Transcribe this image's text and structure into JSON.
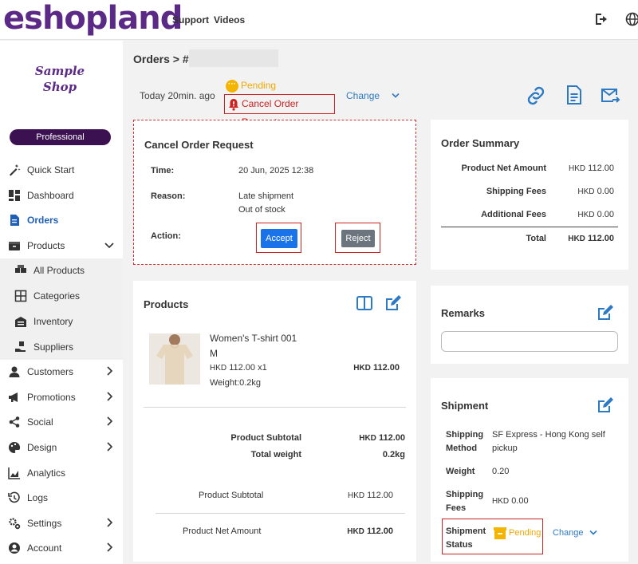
{
  "brand": {
    "logo": "eshopland"
  },
  "topnav": {
    "support": "Support",
    "videos": "Videos"
  },
  "sidebar": {
    "shop_name_line1": "Sample",
    "shop_name_line2": "Shop",
    "plan": "Professional",
    "items": [
      {
        "label": "Quick Start"
      },
      {
        "label": "Dashboard"
      },
      {
        "label": "Orders"
      },
      {
        "label": "Products"
      },
      {
        "label": "Customers"
      },
      {
        "label": "Promotions"
      },
      {
        "label": "Social"
      },
      {
        "label": "Design"
      },
      {
        "label": "Analytics"
      },
      {
        "label": "Logs"
      },
      {
        "label": "Settings"
      },
      {
        "label": "Account"
      }
    ],
    "sub_items": [
      {
        "label": "All Products"
      },
      {
        "label": "Categories"
      },
      {
        "label": "Inventory"
      },
      {
        "label": "Suppliers"
      }
    ]
  },
  "order": {
    "breadcrumb": "Orders > #",
    "time": "Today 20min. ago",
    "status": "Pending",
    "cancel_request_badge": "Cancel Order Request",
    "change": "Change"
  },
  "cancel_request": {
    "title": "Cancel Order Request",
    "time_label": "Time:",
    "time_value": "20 Jun, 2025 12:38",
    "reason_label": "Reason:",
    "reason_line1": "Late shipment",
    "reason_line2": "Out of stock",
    "action_label": "Action:",
    "accept": "Accept",
    "reject": "Reject"
  },
  "order_summary": {
    "title": "Order Summary",
    "rows": [
      {
        "label": "Product Net Amount",
        "currency": "HKD",
        "value": "112.00"
      },
      {
        "label": "Shipping Fees",
        "currency": "HKD",
        "value": "0.00"
      },
      {
        "label": "Additional Fees",
        "currency": "HKD",
        "value": "0.00"
      }
    ],
    "total_label": "Total",
    "total_currency": "HKD",
    "total_value": "112.00"
  },
  "products": {
    "title": "Products",
    "item": {
      "name": "Women's T-shirt 001",
      "variant": "M",
      "price_currency": "HKD",
      "price_qty": "112.00 x1",
      "weight": "Weight:0.2kg",
      "line_currency": "HKD",
      "line_total": "112.00"
    },
    "subtotal_label": "Product Subtotal",
    "subtotal_currency": "HKD",
    "subtotal_value": "112.00",
    "weight_label": "Total weight",
    "weight_value": "0.2kg",
    "subtotal2_label": "Product Subtotal",
    "subtotal2_currency": "HKD",
    "subtotal2_value": "112.00",
    "net_label": "Product Net Amount",
    "net_currency": "HKD",
    "net_value": "112.00"
  },
  "remarks": {
    "title": "Remarks",
    "value": ""
  },
  "shipment": {
    "title": "Shipment",
    "method_label_1": "Shipping",
    "method_label_2": "Method",
    "method_value_1": "SF Express - Hong Kong self",
    "method_value_2": "pickup",
    "weight_label": "Weight",
    "weight_value": "0.20",
    "fees_label_1": "Shipping",
    "fees_label_2": "Fees",
    "fees_currency": "HKD",
    "fees_value": "0.00",
    "status_label_1": "Shipment",
    "status_label_2": "Status",
    "status_value": "Pending",
    "change": "Change"
  },
  "colors": {
    "brand": "#5b2a86",
    "accent": "#2d7ac4",
    "warning": "#f0a800",
    "danger": "#cc2222",
    "accept": "#1a73e8"
  }
}
